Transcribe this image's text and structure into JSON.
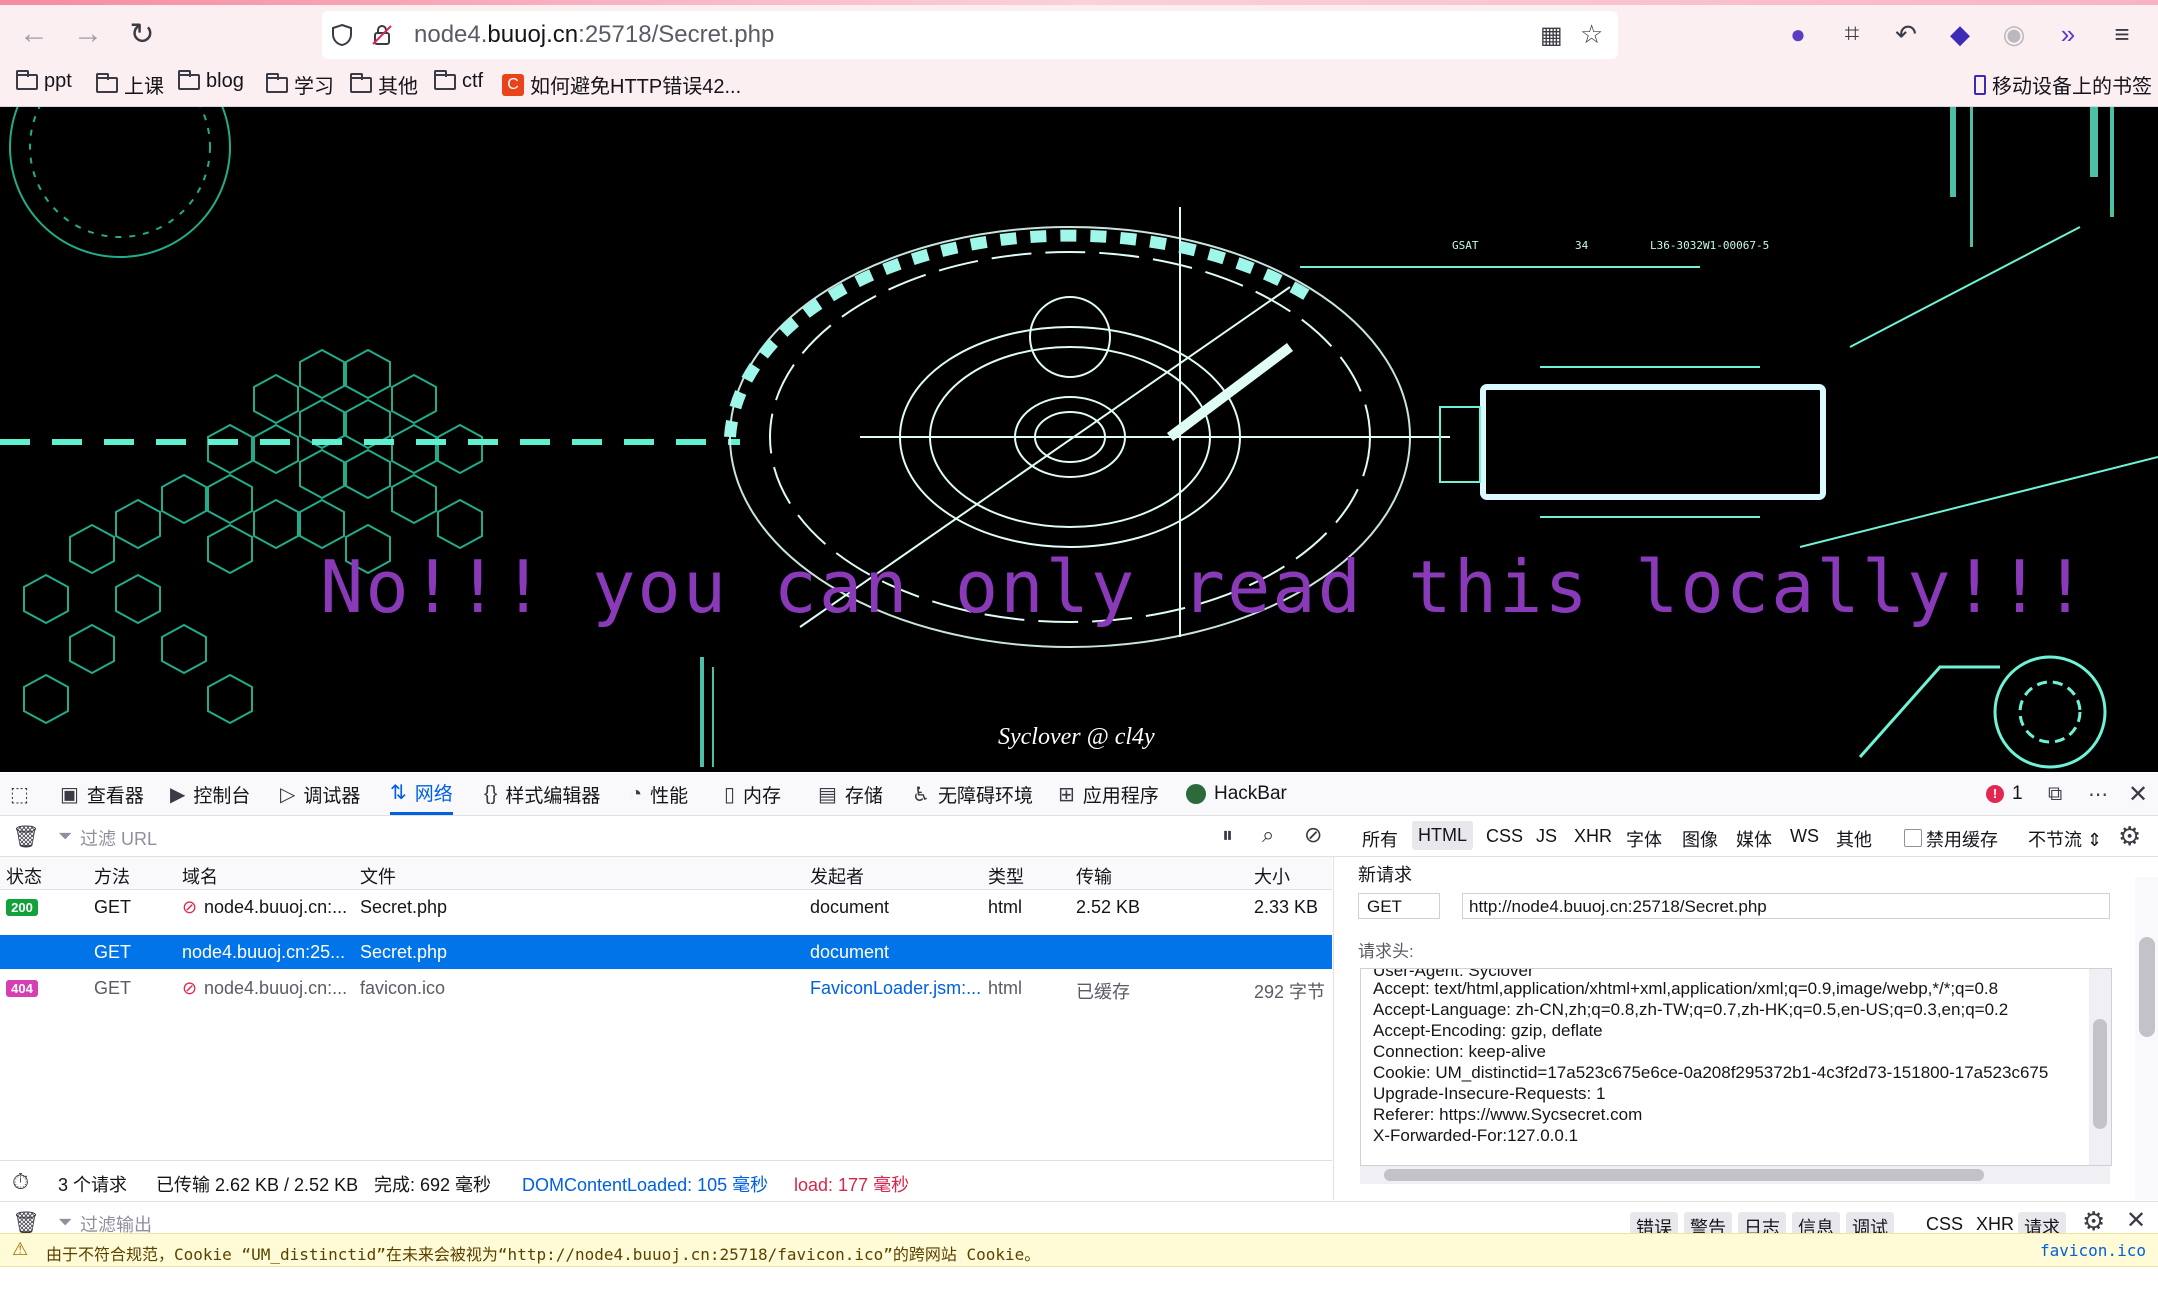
{
  "browser": {
    "url_prefix": "node4.",
    "url_domain": "buuoj.cn",
    "url_suffix": ":25718/Secret.php",
    "bookmarks": [
      "ppt",
      "上课",
      "blog",
      "学习",
      "其他",
      "ctf"
    ],
    "bookmark_link": "如何避免HTTP错误42...",
    "mobile_bookmarks": "移动设备上的书签"
  },
  "page": {
    "message": "No!!! you can only read this locally!!!",
    "signature": "Syclover @ cl4y",
    "hud_labels": [
      "GSAT",
      "34",
      "L36-3032W1-00067-5"
    ]
  },
  "devtools": {
    "tabs": [
      "查看器",
      "控制台",
      "调试器",
      "网络",
      "样式编辑器",
      "性能",
      "内存",
      "存储",
      "无障碍环境",
      "应用程序",
      "HackBar"
    ],
    "error_count": "1",
    "filter_placeholder": "过滤 URL",
    "type_filters": [
      "所有",
      "HTML",
      "CSS",
      "JS",
      "XHR",
      "字体",
      "图像",
      "媒体",
      "WS",
      "其他"
    ],
    "disable_cache": "禁用缓存",
    "throttle": "不节流 ⇕",
    "columns": [
      "状态",
      "方法",
      "域名",
      "文件",
      "发起者",
      "类型",
      "传输",
      "大小"
    ],
    "rows": [
      {
        "status": "200",
        "method": "GET",
        "domain": "node4.buuoj.cn:...",
        "file": "Secret.php",
        "initiator": "document",
        "type": "html",
        "transfer": "2.52 KB",
        "size": "2.33 KB"
      },
      {
        "status": "",
        "method": "GET",
        "domain": "node4.buuoj.cn:25...",
        "file": "Secret.php",
        "initiator": "document",
        "type": "",
        "transfer": "",
        "size": ""
      },
      {
        "status": "404",
        "method": "GET",
        "domain": "node4.buuoj.cn:...",
        "file": "favicon.ico",
        "initiator": "FaviconLoader.jsm:...",
        "type": "html",
        "transfer": "已缓存",
        "size": "292 字节"
      }
    ],
    "summary": {
      "requests": "3 个请求",
      "transferred": "已传输 2.62 KB / 2.52 KB",
      "finish": "完成: 692 毫秒",
      "dcl": "DOMContentLoaded: 105 毫秒",
      "load": "load: 177 毫秒"
    },
    "new_request": {
      "title": "新请求",
      "method": "GET",
      "url": "http://node4.buuoj.cn:25718/Secret.php",
      "headers_label": "请求头:",
      "headers": [
        "User-Agent: Syclover",
        "Accept: text/html,application/xhtml+xml,application/xml;q=0.9,image/webp,*/*;q=0.8",
        "Accept-Language: zh-CN,zh;q=0.8,zh-TW;q=0.7,zh-HK;q=0.5,en-US;q=0.3,en;q=0.2",
        "Accept-Encoding: gzip, deflate",
        "Connection: keep-alive",
        "Cookie: UM_distinctid=17a523c675e6ce-0a208f295372b1-4c3f2d73-151800-17a523c675",
        "Upgrade-Insecure-Requests: 1",
        "Referer: https://www.Sycsecret.com",
        "X-Forwarded-For:127.0.0.1"
      ]
    },
    "console": {
      "filter_placeholder": "过滤输出",
      "levels": [
        "错误",
        "警告",
        "日志",
        "信息",
        "调试"
      ],
      "categories": [
        "CSS",
        "XHR",
        "请求"
      ],
      "warning": "由于不符合规范，Cookie “UM_distinctid”在未来会被视为“http://node4.buuoj.cn:25718/favicon.ico”的跨网站 Cookie。",
      "warning_source": "favicon.ico"
    }
  }
}
